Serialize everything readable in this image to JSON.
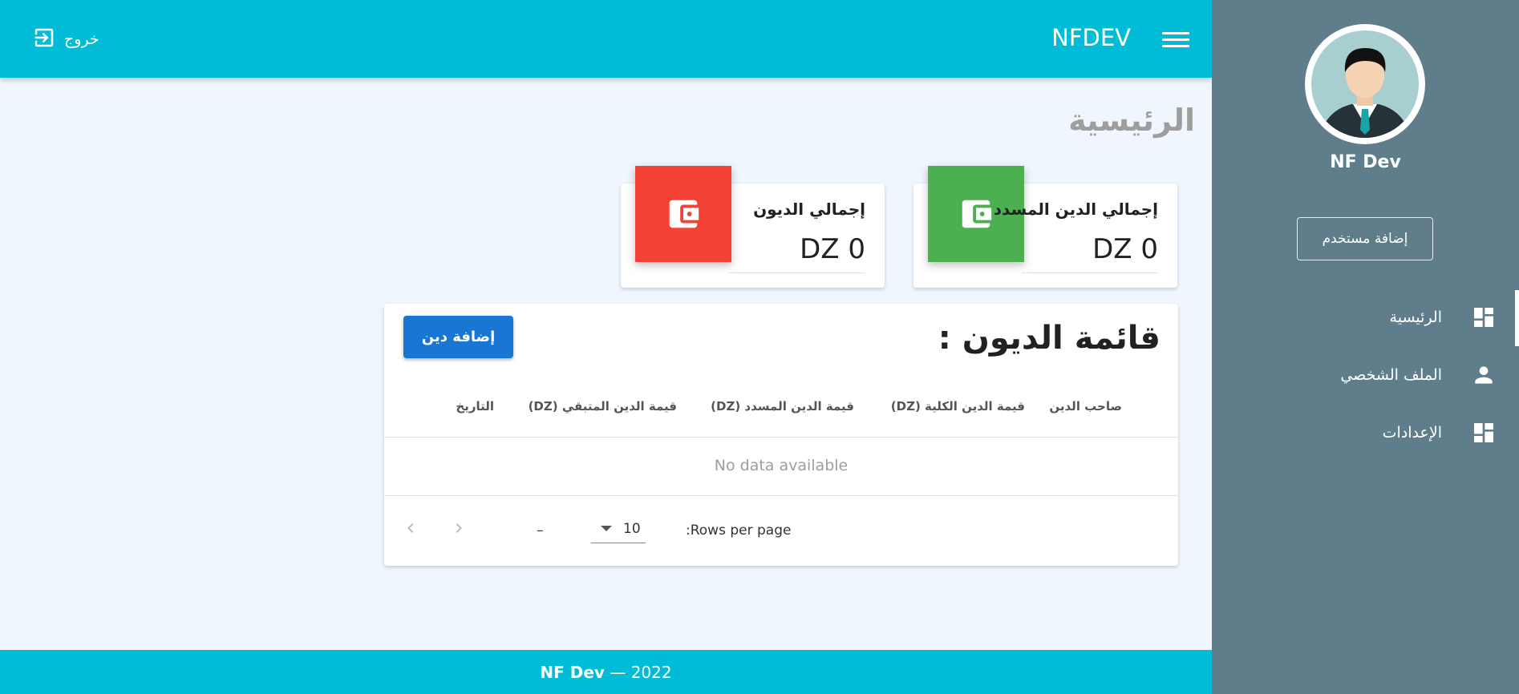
{
  "topbar": {
    "brand": "NFDEV",
    "logout_label": "خروج"
  },
  "sidebar": {
    "user_name": "NF Dev",
    "add_user_label": "إضافة مستخدم",
    "items": [
      {
        "label": "الرئيسية",
        "icon": "dashboard-icon",
        "active": true
      },
      {
        "label": "الملف الشخصي",
        "icon": "person-icon"
      },
      {
        "label": "الإعدادات",
        "icon": "dashboard-icon"
      }
    ]
  },
  "page": {
    "title": "الرئيسية"
  },
  "stats": [
    {
      "title": "إجمالي الدين المسدد",
      "value": "DZ 0",
      "color": "#4caf50",
      "icon": "wallet-icon"
    },
    {
      "title": "إجمالي الديون",
      "value": "DZ 0",
      "color": "#f44336",
      "icon": "wallet-icon"
    }
  ],
  "debts": {
    "title": "قائمة الديون :",
    "add_label": "إضافة دين",
    "columns": [
      "صاحب الدين",
      "قيمة الدين الكلية (DZ)",
      "قيمة الدين المسدد (DZ)",
      "قيمة الدين المتبقي (DZ)",
      "التاريخ"
    ],
    "no_data": "No data available",
    "rows_per_page_label": "Rows per page:",
    "rows_per_page_value": "10",
    "range_text": "–"
  },
  "footer": {
    "brand": "NF Dev",
    "separator": " — ",
    "year": "2022"
  },
  "colors": {
    "primary": "#00bcd6",
    "sidebar": "#607d8b",
    "button": "#1976d2"
  }
}
